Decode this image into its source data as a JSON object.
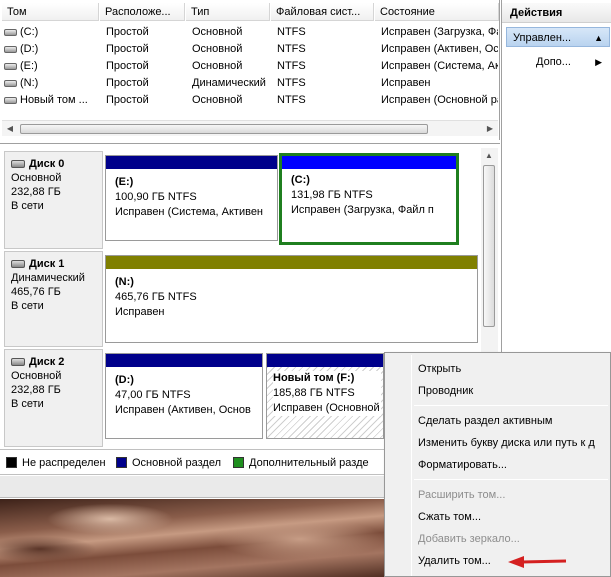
{
  "volume_list": {
    "columns": [
      "Том",
      "Расположе...",
      "Тип",
      "Файловая сист...",
      "Состояние"
    ],
    "rows": [
      {
        "volume": "(C:)",
        "layout": "Простой",
        "type": "Основной",
        "fs": "NTFS",
        "status": "Исправен (Загрузка, Файл п"
      },
      {
        "volume": "(D:)",
        "layout": "Простой",
        "type": "Основной",
        "fs": "NTFS",
        "status": "Исправен (Активен, Основн"
      },
      {
        "volume": "(E:)",
        "layout": "Простой",
        "type": "Основной",
        "fs": "NTFS",
        "status": "Исправен (Система, Активе"
      },
      {
        "volume": "(N:)",
        "layout": "Простой",
        "type": "Динамический",
        "fs": "NTFS",
        "status": "Исправен"
      },
      {
        "volume": "Новый том ...",
        "layout": "Простой",
        "type": "Основной",
        "fs": "NTFS",
        "status": "Исправен (Основной раздел)"
      }
    ]
  },
  "actions": {
    "title": "Действия",
    "group_label": "Управлен...",
    "more_label": "Допо..."
  },
  "disks": [
    {
      "name": "Диск 0",
      "type": "Основной",
      "size": "232,88 ГБ",
      "state": "В сети",
      "partitions": [
        {
          "letter": "(E:)",
          "size": "100,90 ГБ NTFS",
          "status": "Исправен (Система, Активен"
        },
        {
          "letter": "(C:)",
          "size": "131,98 ГБ NTFS",
          "status": "Исправен (Загрузка, Файл п"
        }
      ]
    },
    {
      "name": "Диск 1",
      "type": "Динамический",
      "size": "465,76 ГБ",
      "state": "В сети",
      "partitions": [
        {
          "letter": "(N:)",
          "size": "465,76 ГБ NTFS",
          "status": "Исправен"
        }
      ]
    },
    {
      "name": "Диск 2",
      "type": "Основной",
      "size": "232,88 ГБ",
      "state": "В сети",
      "partitions": [
        {
          "letter": "(D:)",
          "size": "47,00 ГБ NTFS",
          "status": "Исправен (Активен, Основ"
        },
        {
          "letter": "Новый том  (F:)",
          "size": "185,88 ГБ NTFS",
          "status": "Исправен (Основной"
        }
      ]
    }
  ],
  "legend": [
    {
      "label": "Не распределен",
      "color": "#000000"
    },
    {
      "label": "Основной раздел",
      "color": "#00008b"
    },
    {
      "label": "Дополнительный разде",
      "color": "#1f8f1f"
    }
  ],
  "context_menu": {
    "items": [
      {
        "label": "Открыть",
        "enabled": true
      },
      {
        "label": "Проводник",
        "enabled": true
      },
      {
        "label": "Сделать раздел активным",
        "enabled": true
      },
      {
        "label": "Изменить букву диска или путь к д",
        "enabled": true
      },
      {
        "label": "Форматировать...",
        "enabled": true
      },
      {
        "label": "Расширить том...",
        "enabled": false
      },
      {
        "label": "Сжать том...",
        "enabled": true
      },
      {
        "label": "Добавить зеркало...",
        "enabled": false
      },
      {
        "label": "Удалить том...",
        "enabled": true
      }
    ]
  },
  "colors": {
    "primary_partition_bar": "#00008b",
    "dynamic_partition_bar": "#808000",
    "selected_partition_bar": "#0000ff",
    "selected_partition_border": "#1f7f1f",
    "annotation_arrow": "#d42020"
  }
}
